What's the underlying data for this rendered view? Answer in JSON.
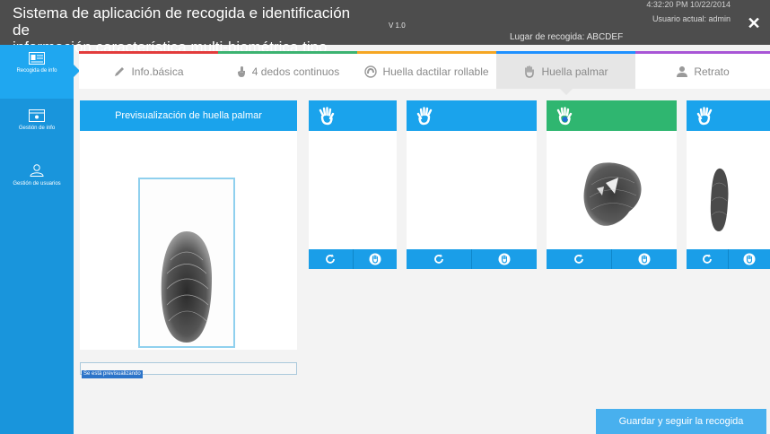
{
  "header": {
    "title_line1": "Sistema de aplicación de recogida e identificación de",
    "title_line2": "información característica multi-biométrica tipo móvil",
    "version": "V 1.0",
    "location": "Lugar de recogida: ABCDEF",
    "datetime": "4:32:20 PM 10/22/2014",
    "user": "Usuario actual: admin",
    "close_symbol": "✕"
  },
  "sidebar": {
    "items": [
      {
        "label": "Recogida de info",
        "icon": "id-card-icon",
        "active": true
      },
      {
        "label": "Gestión de info",
        "icon": "card-icon",
        "active": false
      },
      {
        "label": "Gestión de usuarios",
        "icon": "user-icon",
        "active": false
      }
    ]
  },
  "tabs": [
    {
      "label": "Info.básica",
      "icon": "pencil-icon",
      "color": "#e23c3c"
    },
    {
      "label": "4 dedos continuos",
      "icon": "finger-icon",
      "color": "#3cb371"
    },
    {
      "label": "Huella dactilar rollable",
      "icon": "roll-icon",
      "color": "#f5a623"
    },
    {
      "label": "Huella palmar",
      "icon": "hand-icon",
      "color": "#1e90ff",
      "active": true
    },
    {
      "label": "Retrato",
      "icon": "person-icon",
      "color": "#a855d6"
    }
  ],
  "preview": {
    "title": "Previsualización de huella palmar",
    "status": "Se está previsualizando"
  },
  "cards": [
    {
      "icon": "hand-icon",
      "active": false,
      "print": "none"
    },
    {
      "icon": "hand-icon",
      "active": false,
      "print": "none"
    },
    {
      "icon": "hand-icon",
      "active": true,
      "print": "palm"
    },
    {
      "icon": "hand-icon",
      "active": false,
      "print": "finger"
    }
  ],
  "actions": {
    "save_label": "Guardar y seguir la recogida"
  },
  "colors": {
    "sidebar": "#1995dc",
    "header_blue": "#1aa3ec",
    "active_green": "#2fb670",
    "titlebar": "#4d4d4d"
  }
}
